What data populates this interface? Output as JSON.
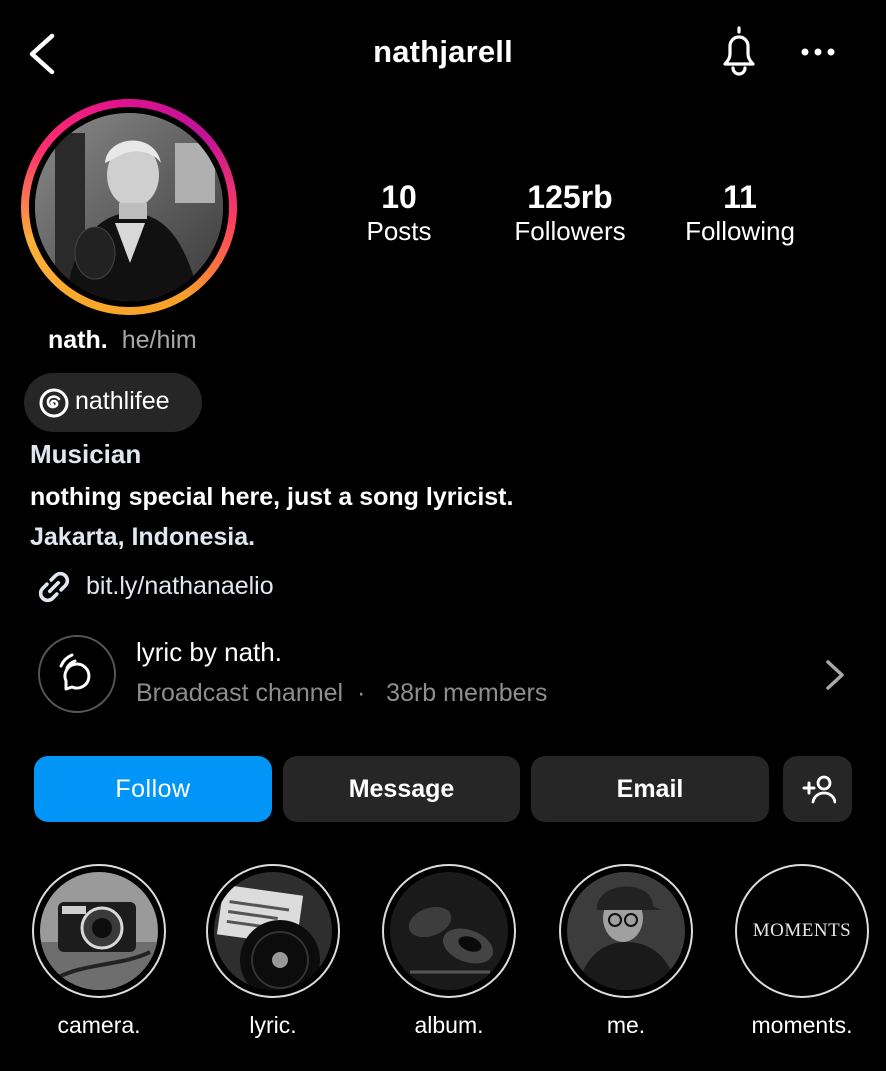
{
  "header": {
    "username": "nathjarell",
    "back_icon": "chevron-left-icon",
    "bell_icon": "bell-icon",
    "more_icon": "more-horizontal-icon"
  },
  "stats": [
    {
      "value": "10",
      "label": "Posts"
    },
    {
      "value": "125rb",
      "label": "Followers"
    },
    {
      "value": "11",
      "label": "Following"
    }
  ],
  "profile": {
    "display_name": "nath.",
    "pronouns": "he/him",
    "threads_handle": "nathlifee",
    "category": "Musician",
    "bio_line1": "nothing special here, just a song lyricist.",
    "bio_line2": "Jakarta, Indonesia.",
    "link": "bit.ly/nathanaelio"
  },
  "broadcast": {
    "title": "lyric by nath.",
    "type": "Broadcast channel",
    "separator": "·",
    "members": "38rb members"
  },
  "buttons": {
    "follow": "Follow",
    "message": "Message",
    "email": "Email",
    "add_icon": "add-person-icon"
  },
  "highlights": [
    {
      "label": "camera."
    },
    {
      "label": "lyric."
    },
    {
      "label": "album."
    },
    {
      "label": "me."
    },
    {
      "label": "moments.",
      "cover_text": "MOMENTS"
    }
  ],
  "colors": {
    "background": "#000000",
    "follow_button": "#0095f6",
    "secondary_button": "#262626",
    "muted_text": "#8e8e8e",
    "link_text": "#e0e7f1"
  }
}
